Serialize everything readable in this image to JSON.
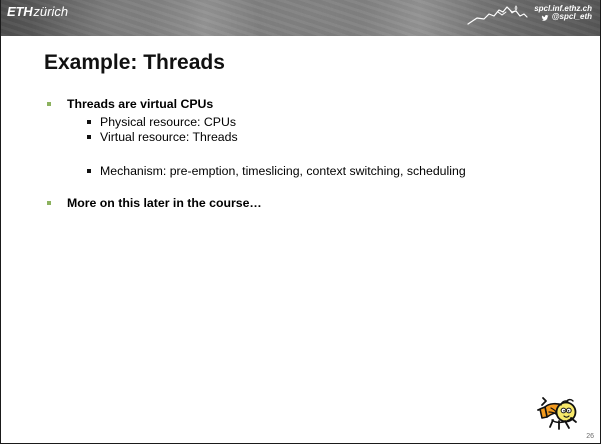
{
  "header": {
    "brand_bold": "ETH",
    "brand_light": "zürich",
    "website": "spcl.inf.ethz.ch",
    "twitter": "@spcl_eth",
    "mountain_icon": "mountain-line-icon",
    "twitter_icon_name": "twitter-bird-icon",
    "colors": {
      "header_text": "#ffffff",
      "header_base": "#7a7a7a"
    }
  },
  "slide": {
    "title": "Example: Threads",
    "bullets": [
      {
        "text": "Threads are virtual CPUs",
        "sub_items": [
          "Physical resource: CPUs",
          "Virtual resource: Threads",
          "Mechanism: pre-emption, timeslicing, context switching, scheduling"
        ]
      },
      {
        "text": "More on this later in the course…"
      }
    ],
    "page_number": "26",
    "colors": {
      "bullet_green": "#8cb25f",
      "text": "#000000",
      "border": "#1a1a1a"
    }
  },
  "mascot": {
    "icon_name": "cartoon-mascot-icon",
    "colors": {
      "orange": "#f39a1e",
      "yellow": "#f7e86a",
      "outline": "#111111"
    }
  }
}
